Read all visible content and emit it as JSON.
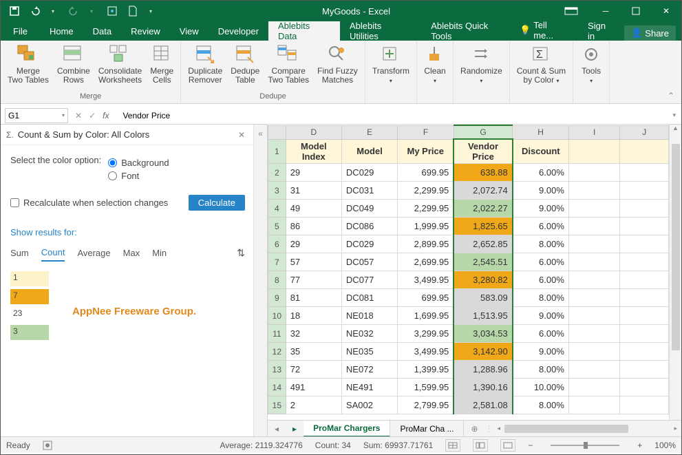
{
  "title": "MyGoods - Excel",
  "tabs": {
    "file": "File",
    "home": "Home",
    "data": "Data",
    "review": "Review",
    "view": "View",
    "developer": "Developer",
    "ablebits_data": "Ablebits Data",
    "ablebits_util": "Ablebits Utilities",
    "ablebits_quick": "Ablebits Quick Tools",
    "tellme": "Tell me...",
    "signin": "Sign in",
    "share": "Share"
  },
  "ribbon": {
    "merge": {
      "label": "Merge",
      "btns": {
        "merge_tables": "Merge\nTwo Tables",
        "combine_rows": "Combine\nRows",
        "consolidate": "Consolidate\nWorksheets",
        "merge_cells": "Merge\nCells"
      }
    },
    "dedupe": {
      "label": "Dedupe",
      "btns": {
        "dup_remover": "Duplicate\nRemover",
        "dedupe_table": "Dedupe\nTable",
        "compare": "Compare\nTwo Tables",
        "fuzzy": "Find Fuzzy\nMatches"
      }
    },
    "other": {
      "transform": "Transform",
      "clean": "Clean",
      "randomize": "Randomize",
      "countsum": "Count & Sum\nby Color",
      "tools": "Tools"
    }
  },
  "namebox": "G1",
  "formula": "Vendor Price",
  "panel": {
    "title": "Count & Sum by Color: All Colors",
    "select_label": "Select the color option:",
    "opt_bg": "Background",
    "opt_font": "Font",
    "recalc": "Recalculate when selection changes",
    "calc_btn": "Calculate",
    "show_results": "Show results for:",
    "stats": {
      "sum": "Sum",
      "count": "Count",
      "avg": "Average",
      "max": "Max",
      "min": "Min"
    },
    "swatches": [
      {
        "c": "#fdf3c8",
        "v": "1"
      },
      {
        "c": "#f0a818",
        "v": "7"
      },
      {
        "c": "",
        "v": "23"
      },
      {
        "c": "#b6d7a8",
        "v": "3"
      }
    ],
    "watermark": "AppNee Freeware Group."
  },
  "cols": [
    "D",
    "E",
    "F",
    "G",
    "H",
    "I",
    "J"
  ],
  "headers": [
    "Model Index",
    "Model",
    "My Price",
    "Vendor Price",
    "Discount"
  ],
  "rows": [
    {
      "r": 2,
      "d": "29",
      "e": "DC029",
      "f": "699.95",
      "g": "638.88",
      "gc": "#f0a818",
      "h": "6.00%"
    },
    {
      "r": 3,
      "d": "31",
      "e": "DC031",
      "f": "2,299.95",
      "g": "2,072.74",
      "gc": "#d9d9d9",
      "h": "9.00%"
    },
    {
      "r": 4,
      "d": "49",
      "e": "DC049",
      "f": "2,299.95",
      "g": "2,022.27",
      "gc": "#b6d7a8",
      "h": "9.00%"
    },
    {
      "r": 5,
      "d": "86",
      "e": "DC086",
      "f": "1,999.95",
      "g": "1,825.65",
      "gc": "#f0a818",
      "h": "6.00%"
    },
    {
      "r": 6,
      "d": "29",
      "e": "DC029",
      "f": "2,899.95",
      "g": "2,652.85",
      "gc": "#d9d9d9",
      "h": "8.00%"
    },
    {
      "r": 7,
      "d": "57",
      "e": "DC057",
      "f": "2,699.95",
      "g": "2,545.51",
      "gc": "#b6d7a8",
      "h": "6.00%"
    },
    {
      "r": 8,
      "d": "77",
      "e": "DC077",
      "f": "3,499.95",
      "g": "3,280.82",
      "gc": "#f0a818",
      "h": "6.00%"
    },
    {
      "r": 9,
      "d": "81",
      "e": "DC081",
      "f": "699.95",
      "g": "583.09",
      "gc": "#d9d9d9",
      "h": "8.00%"
    },
    {
      "r": 10,
      "d": "18",
      "e": "NE018",
      "f": "1,699.95",
      "g": "1,513.95",
      "gc": "#d9d9d9",
      "h": "9.00%"
    },
    {
      "r": 11,
      "d": "32",
      "e": "NE032",
      "f": "3,299.95",
      "g": "3,034.53",
      "gc": "#b6d7a8",
      "h": "6.00%"
    },
    {
      "r": 12,
      "d": "35",
      "e": "NE035",
      "f": "3,499.95",
      "g": "3,142.90",
      "gc": "#f0a818",
      "h": "9.00%"
    },
    {
      "r": 13,
      "d": "72",
      "e": "NE072",
      "f": "1,399.95",
      "g": "1,288.96",
      "gc": "#d9d9d9",
      "h": "8.00%"
    },
    {
      "r": 14,
      "d": "491",
      "e": "NE491",
      "f": "1,599.95",
      "g": "1,390.16",
      "gc": "#d9d9d9",
      "h": "10.00%"
    },
    {
      "r": 15,
      "d": "2",
      "e": "SA002",
      "f": "2,799.95",
      "g": "2,581.08",
      "gc": "#d9d9d9",
      "h": "8.00%"
    }
  ],
  "sheets": {
    "active": "ProMar Chargers",
    "other": "ProMar Cha ..."
  },
  "status": {
    "ready": "Ready",
    "avg": "Average: 2119.324776",
    "count": "Count: 34",
    "sum": "Sum: 69937.71761",
    "zoom": "100%"
  }
}
